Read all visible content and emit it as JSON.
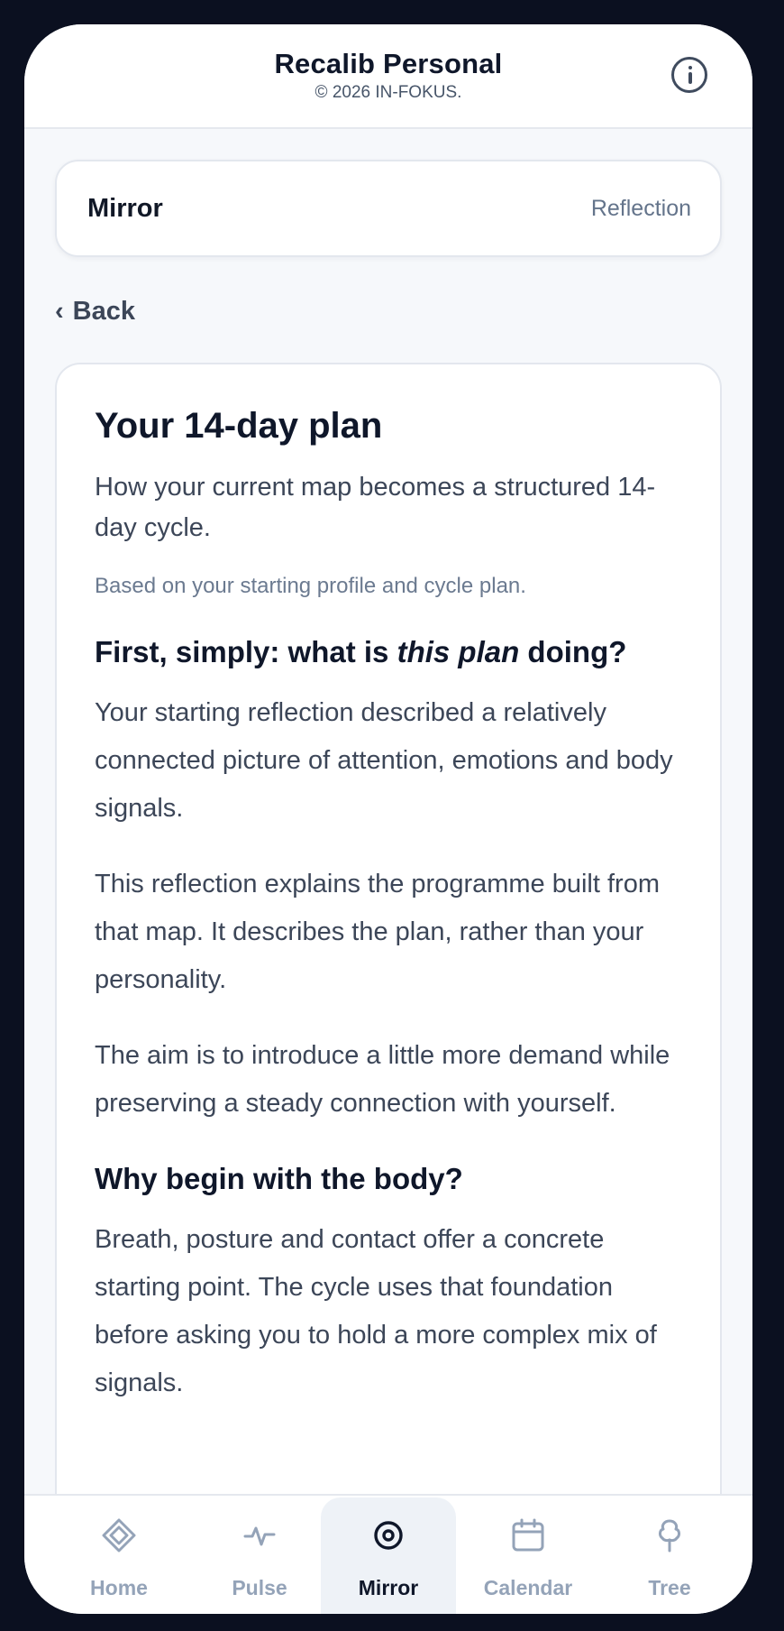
{
  "header": {
    "title": "Recalib Personal",
    "copyright": "© 2026 IN-FOKUS.",
    "info_icon": "info-circle-icon"
  },
  "section": {
    "title": "Mirror",
    "tag": "Reflection"
  },
  "back": {
    "chevron": "‹",
    "label": "Back"
  },
  "article": {
    "title": "Your 14-day plan",
    "lead": "How your current map becomes a structured 14-day cycle.",
    "basis": "Based on your starting profile and cycle plan.",
    "section1": {
      "heading_prefix": "First, simply: what is ",
      "heading_emphasis": "this plan",
      "heading_suffix": " doing?",
      "paragraphs": [
        "Your starting reflection described a relatively connected picture of attention, emotions and body signals.",
        "This reflection explains the programme built from that map. It describes the plan, rather than your personality.",
        "The aim is to introduce a little more demand while preserving a steady connection with yourself."
      ]
    },
    "section2": {
      "heading": "Why begin with the body?",
      "paragraphs": [
        "Breath, posture and contact offer a concrete starting point. The cycle uses that foundation before asking you to hold a more complex mix of signals."
      ]
    }
  },
  "tabbar": {
    "active": "Mirror",
    "active_color": "#0f172a",
    "inactive_color": "#94a3b8",
    "tabs": [
      {
        "label": "Home",
        "icon": "diamond-icon"
      },
      {
        "label": "Pulse",
        "icon": "pulse-icon"
      },
      {
        "label": "Mirror",
        "icon": "target-icon"
      },
      {
        "label": "Calendar",
        "icon": "calendar-icon"
      },
      {
        "label": "Tree",
        "icon": "tree-icon"
      }
    ]
  }
}
